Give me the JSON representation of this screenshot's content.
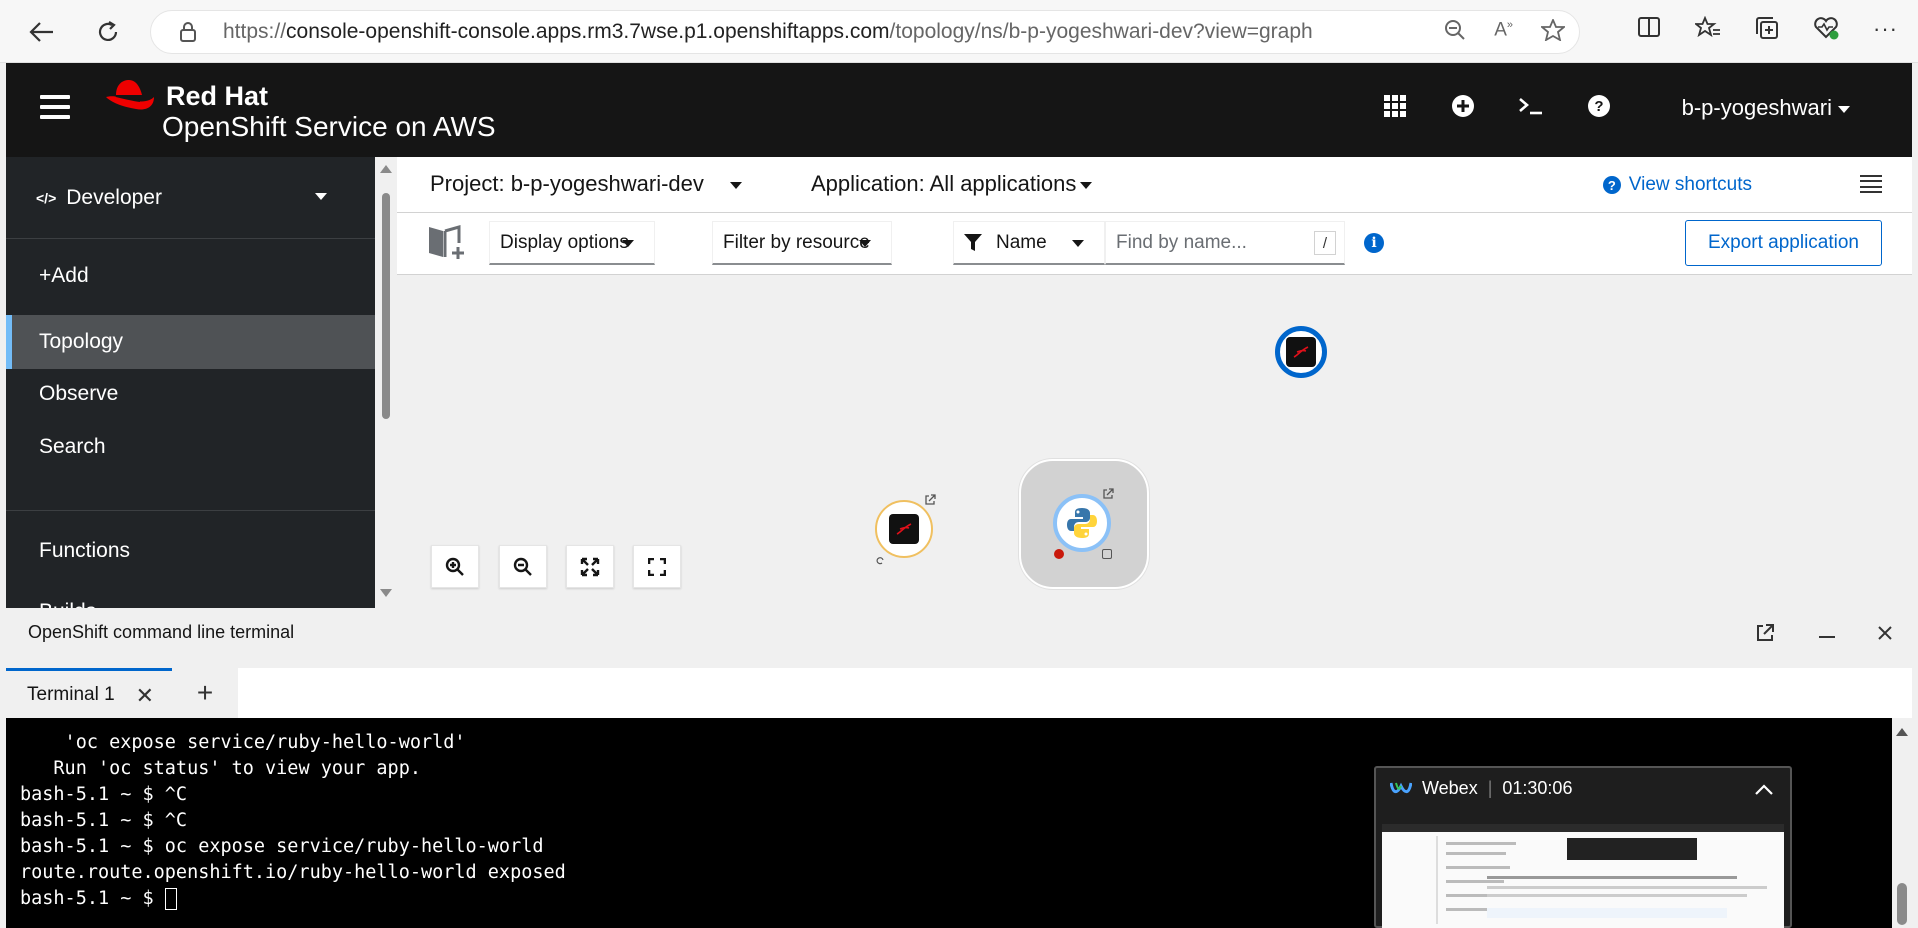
{
  "browser": {
    "url_prefix": "https://",
    "url_host": "console-openshift-console.apps.rm3.7wse.p1.openshiftapps.com",
    "url_path": "/topology/ns/b-p-yogeshwari-dev?view=graph"
  },
  "masthead": {
    "brand_line1": "Red Hat",
    "brand_line2_bold": "OpenShift",
    "brand_line2_rest": " Service on AWS",
    "user": "b-p-yogeshwari"
  },
  "sidebar": {
    "perspective": "Developer",
    "items": [
      "+Add",
      "Topology",
      "Observe",
      "Search",
      "Functions",
      "Builds"
    ]
  },
  "topology": {
    "project_label": "Project: b-p-yogeshwari-dev",
    "application_label": "Application: All applications",
    "view_shortcuts": "View shortcuts",
    "display_options": "Display options",
    "filter_by_resource": "Filter by resource",
    "filter_type": "Name",
    "find_placeholder": "Find by name...",
    "find_shortcut": "/",
    "export_button": "Export application"
  },
  "terminal": {
    "panel_title": "OpenShift command line terminal",
    "tab_label": "Terminal 1",
    "lines": [
      "    'oc expose service/ruby-hello-world'",
      "   Run 'oc status' to view your app.",
      "bash-5.1 ~ $ ^C",
      "bash-5.1 ~ $ ^C",
      "bash-5.1 ~ $ oc expose service/ruby-hello-world",
      "route.route.openshift.io/ruby-hello-world exposed",
      "bash-5.1 ~ $ "
    ]
  },
  "webex": {
    "app": "Webex",
    "timer": "01:30:06"
  },
  "colors": {
    "masthead": "#151515",
    "sidebar": "#212427",
    "accent": "#0066cc",
    "active_border": "#73bcf7"
  }
}
